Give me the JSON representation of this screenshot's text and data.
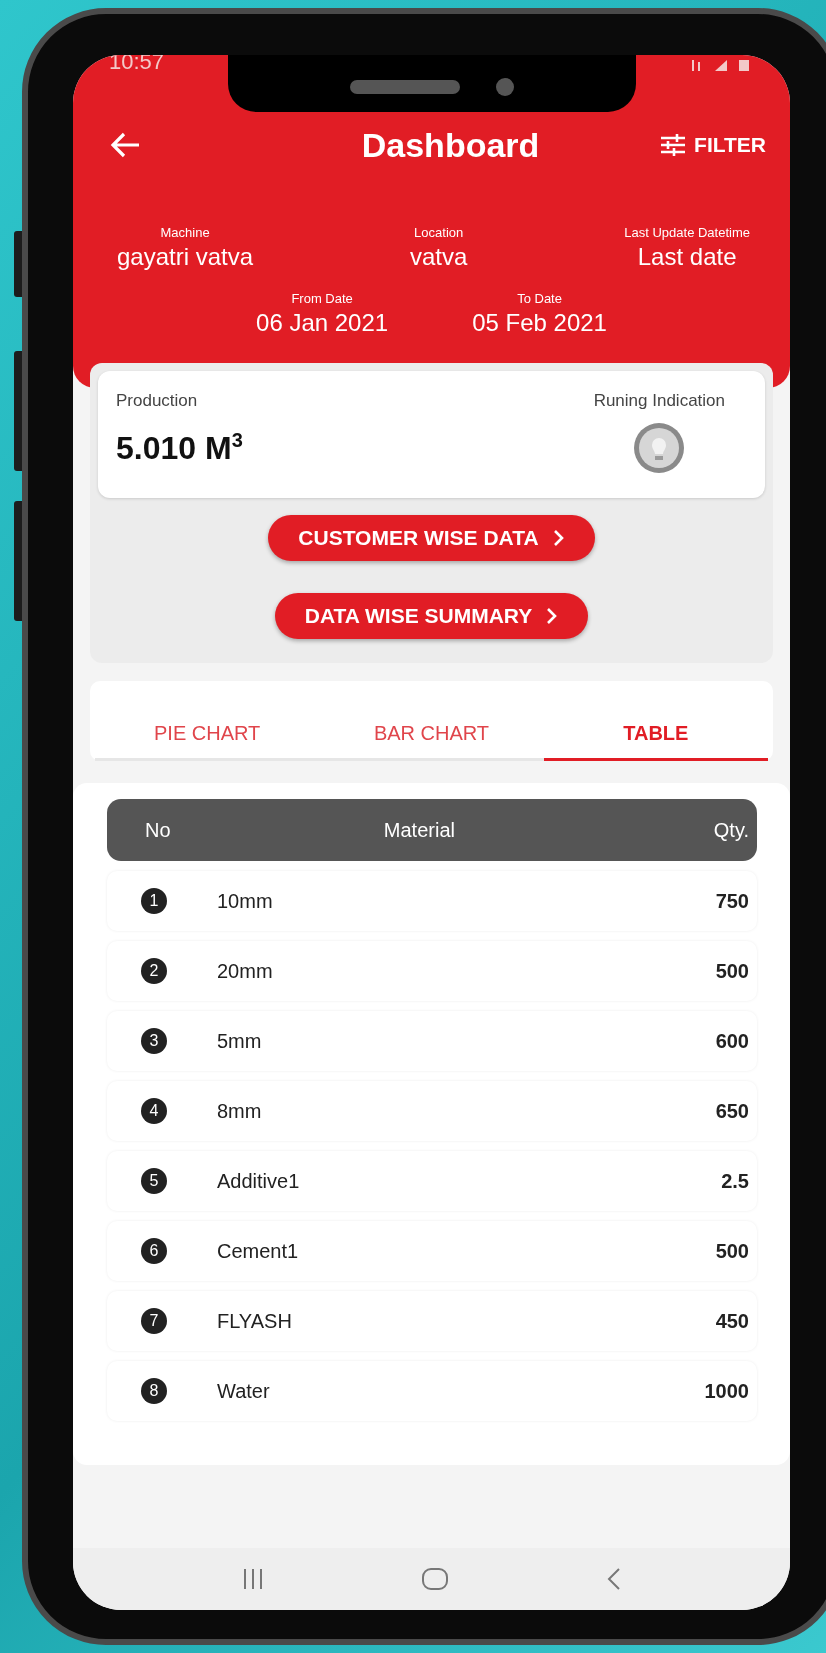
{
  "status_bar": {
    "time": "10:57"
  },
  "header": {
    "title": "Dashboard",
    "filter_label": "FILTER"
  },
  "info": [
    {
      "label": "Machine",
      "value": "gayatri vatva"
    },
    {
      "label": "Location",
      "value": "vatva"
    },
    {
      "label": "Last Update Datetime",
      "value": "Last date"
    }
  ],
  "dates": [
    {
      "label": "From Date",
      "value": "06 Jan 2021"
    },
    {
      "label": "To Date",
      "value": "05 Feb 2021"
    }
  ],
  "production": {
    "label": "Production",
    "value": "5.010 M$^{3}$",
    "indicator_label": "Runing Indication",
    "running": false
  },
  "buttons": [
    "CUSTOMER WISE DATA",
    "DATA WISE SUMMARY"
  ],
  "tabs": [
    {
      "label": "PIE CHART",
      "selected": false
    },
    {
      "label": "BAR CHART",
      "selected": false
    },
    {
      "label": "TABLE",
      "selected": true
    }
  ],
  "table": {
    "columns": [
      "No",
      "Material",
      "Qty."
    ],
    "rows": [
      {
        "no": "1",
        "material": "10mm",
        "qty": "750"
      },
      {
        "no": "2",
        "material": "20mm",
        "qty": "500"
      },
      {
        "no": "3",
        "material": "5mm",
        "qty": "600"
      },
      {
        "no": "4",
        "material": "8mm",
        "qty": "650"
      },
      {
        "no": "5",
        "material": "Additive1",
        "qty": "2.5"
      },
      {
        "no": "6",
        "material": "Cement1",
        "qty": "500"
      },
      {
        "no": "7",
        "material": "FLYASH",
        "qty": "450"
      },
      {
        "no": "8",
        "material": "Water",
        "qty": "1000"
      }
    ]
  }
}
